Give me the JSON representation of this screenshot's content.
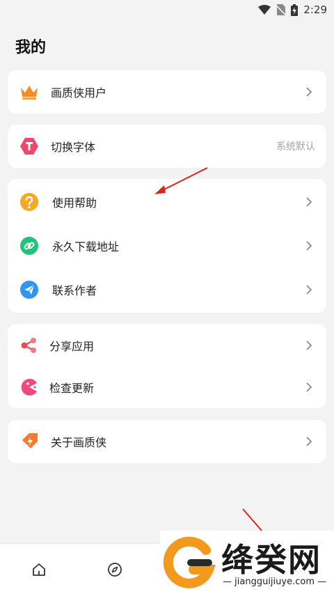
{
  "status_bar": {
    "time": "2:29",
    "icons": [
      "wifi-icon",
      "no-sim-icon",
      "battery-charging-icon"
    ]
  },
  "page": {
    "title": "我的"
  },
  "cards": {
    "vip": {
      "label": "画质侠用户",
      "icon": "crown-icon",
      "icon_color": "#f28c28"
    },
    "font": {
      "label": "切换字体",
      "value": "系统默认",
      "icon": "font-t-icon",
      "icon_color": "#f0476b"
    },
    "help": {
      "label": "使用帮助",
      "icon": "question-icon",
      "icon_color": "#f7a823"
    },
    "download": {
      "label": "永久下载地址",
      "icon": "link-icon",
      "icon_color": "#22c27a"
    },
    "contact": {
      "label": "联系作者",
      "icon": "send-icon",
      "icon_color": "#2e96f0"
    },
    "share": {
      "label": "分享应用",
      "icon": "share-icon",
      "icon_color": "#ee4a5a"
    },
    "update": {
      "label": "检查更新",
      "icon": "pacman-icon",
      "icon_color": "#ee4a7a"
    },
    "about": {
      "label": "关于画质侠",
      "icon": "tag-bolt-icon",
      "icon_color": "#f57a2b"
    }
  },
  "bottom_nav": {
    "items": [
      "home-icon",
      "compass-icon"
    ]
  },
  "watermark": {
    "text": "绛癸网",
    "url": "jiangguijiuye.com"
  },
  "colors": {
    "background": "#f3f3f4",
    "card": "#ffffff",
    "annotation_arrow": "#d9261c"
  }
}
